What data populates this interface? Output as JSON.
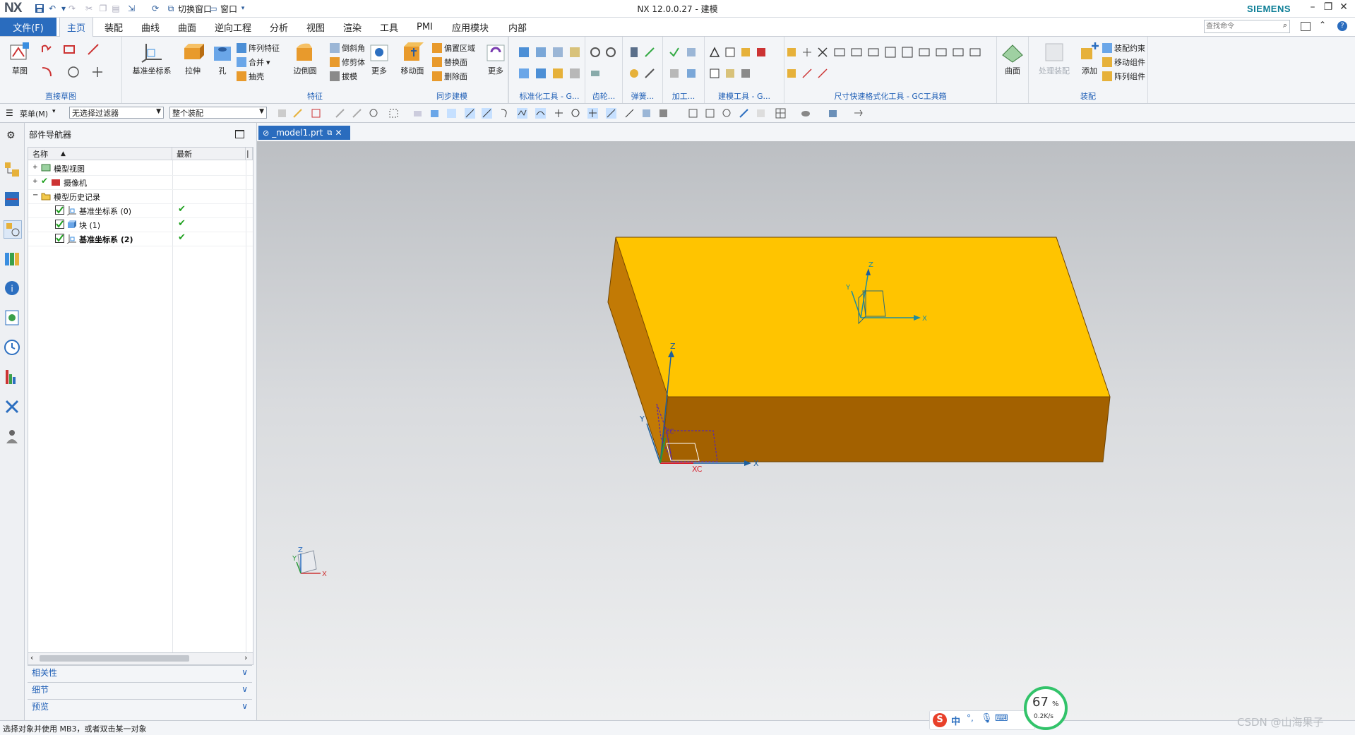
{
  "app": {
    "logo": "NX",
    "title": "NX 12.0.0.27 - 建模",
    "brand": "SIEMENS"
  },
  "quick_access": {
    "switch_window": "切换窗口",
    "window": "窗口"
  },
  "search": {
    "placeholder": "查找命令"
  },
  "menu": {
    "file": "文件(F)",
    "tabs": [
      "主页",
      "装配",
      "曲线",
      "曲面",
      "逆向工程",
      "分析",
      "视图",
      "渲染",
      "工具",
      "PMI",
      "应用模块",
      "内部"
    ]
  },
  "ribbon": {
    "direct_sketch": {
      "label": "直接草图",
      "sketch": "草图"
    },
    "feature": {
      "label": "特征",
      "datum_csys": "基准坐标系",
      "extrude": "拉伸",
      "hole": "孔",
      "pattern_feature": "阵列特征",
      "unite": "合并",
      "shell": "抽壳",
      "edge_blend": "边倒圆",
      "chamfer": "倒斜角",
      "trim_body": "修剪体",
      "draft": "拔模",
      "more": "更多"
    },
    "sync": {
      "label": "同步建模",
      "move_face": "移动面",
      "offset_region": "偏置区域",
      "replace_face": "替换面",
      "delete_face": "删除面",
      "more": "更多"
    },
    "std_tool": {
      "label": "标准化工具 - G..."
    },
    "gear": {
      "label": "齿轮..."
    },
    "spring": {
      "label": "弹簧..."
    },
    "machining": {
      "label": "加工..."
    },
    "model_tool": {
      "label": "建模工具 - G..."
    },
    "dim": {
      "label": "尺寸快速格式化工具 - GC工具箱"
    },
    "surface": {
      "label": "曲面"
    },
    "assembly": {
      "label": "装配",
      "process_assembly": "处理装配",
      "add": "添加",
      "constraint": "装配约束",
      "move_component": "移动组件",
      "pattern_component": "阵列组件"
    }
  },
  "toolbar2": {
    "menu": "菜单(M)",
    "filter": "无选择过滤器",
    "scope": "整个装配"
  },
  "navigator": {
    "title": "部件导航器",
    "columns": [
      "名称",
      "最新"
    ],
    "rows": [
      {
        "label": "模型视图",
        "expand": "+"
      },
      {
        "label": "摄像机",
        "expand": "+"
      },
      {
        "label": "模型历史记录",
        "expand": "−"
      },
      {
        "label": "基准坐标系 (0)",
        "latest": "✔"
      },
      {
        "label": "块 (1)",
        "latest": "✔"
      },
      {
        "label": "基准坐标系 (2)",
        "latest": "✔"
      }
    ],
    "panels": [
      "相关性",
      "细节",
      "预览"
    ]
  },
  "graphics_tab": {
    "label": "_model1.prt"
  },
  "axes": {
    "x": "X",
    "y": "Y",
    "z": "Z",
    "xc": "XC",
    "zc": "ZC"
  },
  "colors": {
    "accent": "#2a6cbe",
    "block_top": "#ffc400",
    "block_front": "#a36100",
    "block_side": "#c27a05",
    "check": "#1ea01e"
  },
  "status": {
    "text": "选择对象并使用 MB3，或者双击某一对象"
  },
  "net_widget": {
    "percent": "67",
    "unit": "%",
    "speed": "0.2K/s"
  },
  "watermark": "CSDN @山海果子"
}
